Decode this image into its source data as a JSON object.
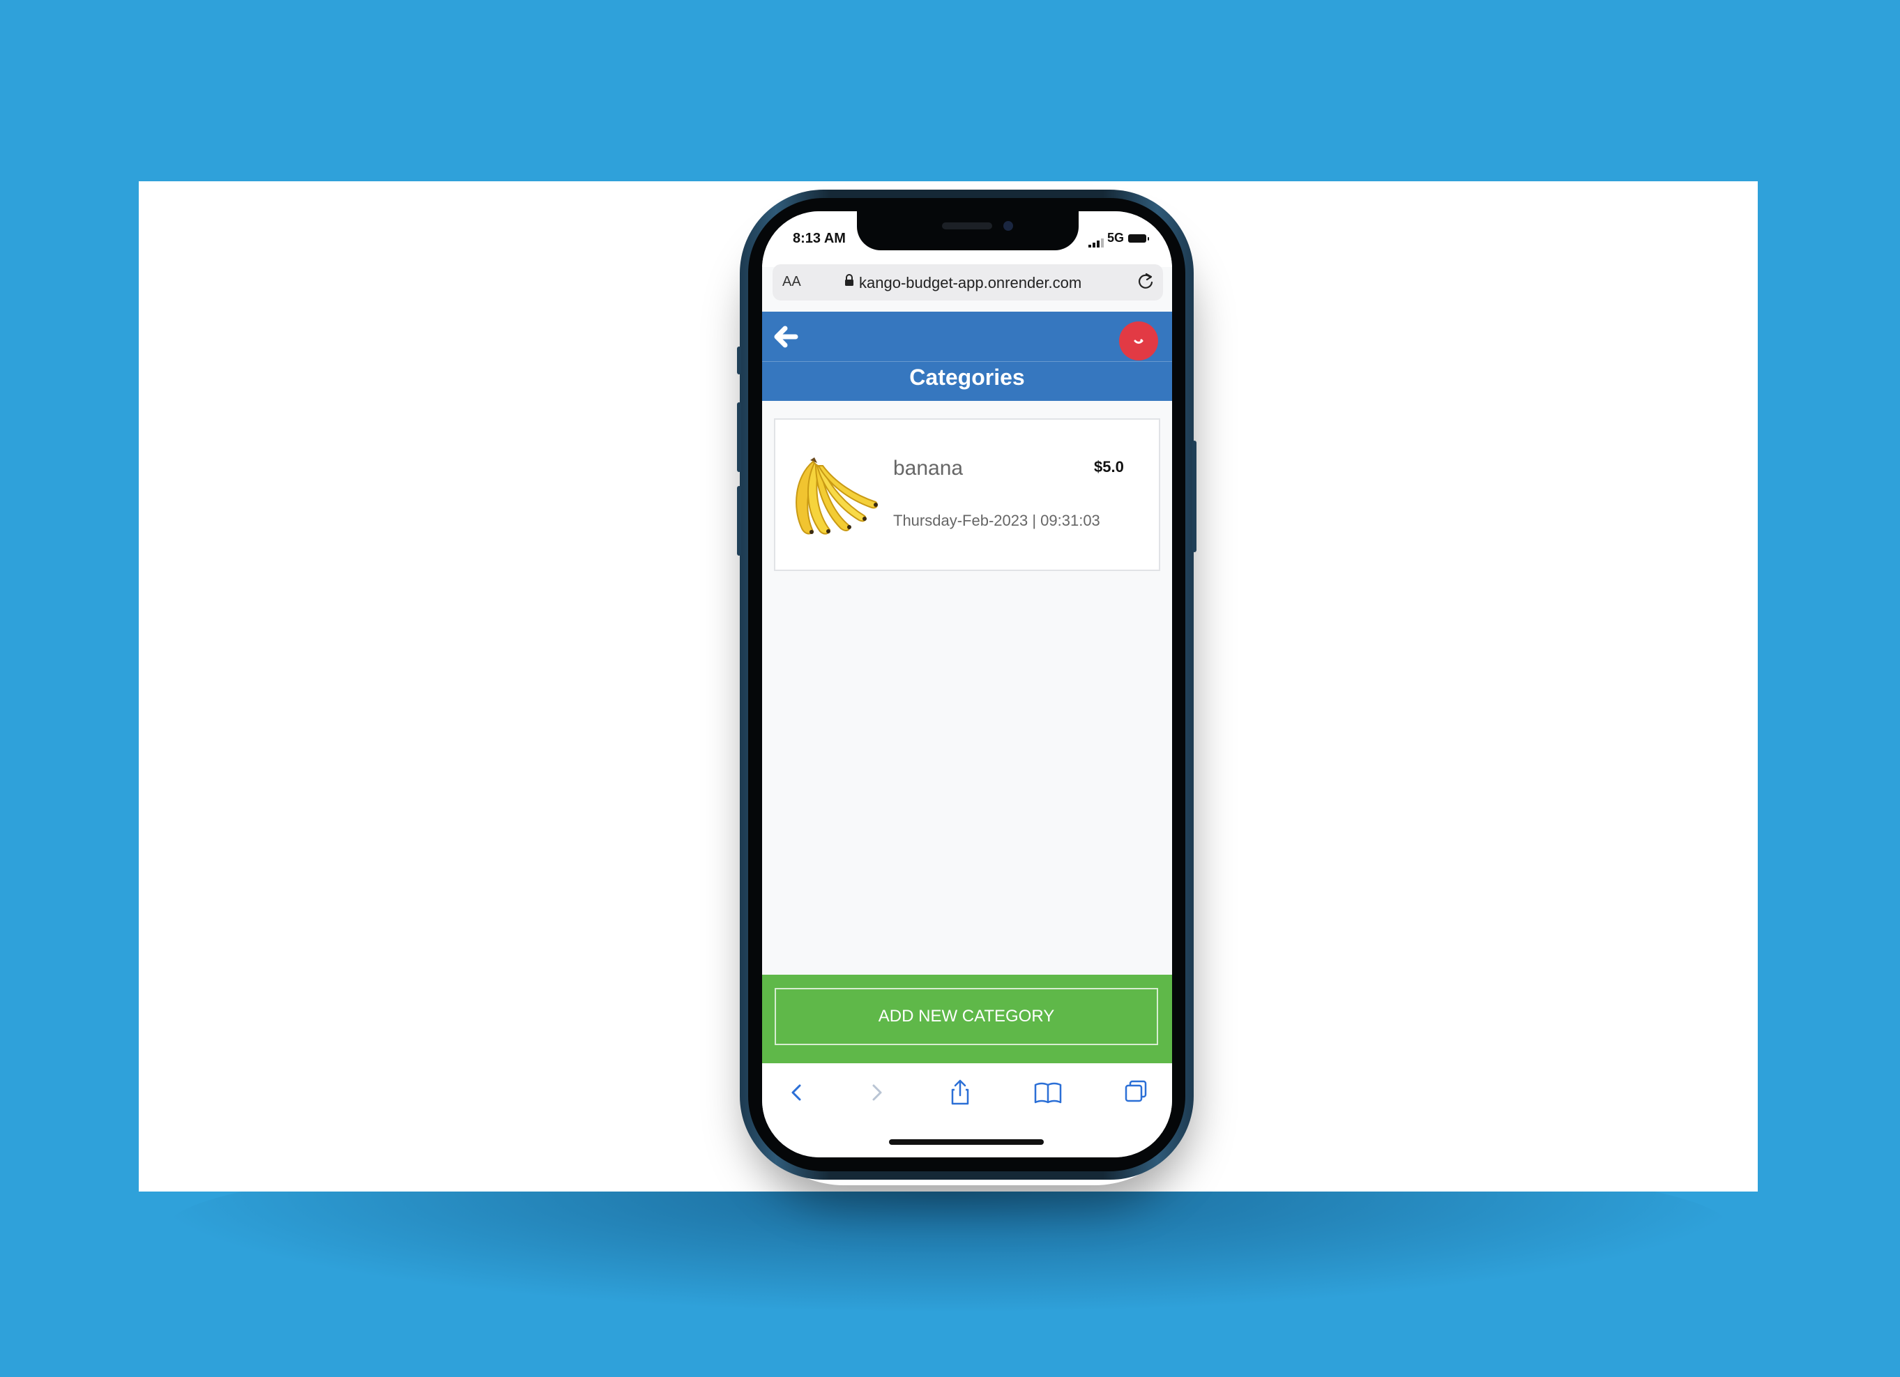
{
  "status_bar": {
    "time": "8:13 AM",
    "network": "5G"
  },
  "browser": {
    "text_size_label": "AA",
    "url": "kango-budget-app.onrender.com"
  },
  "header": {
    "title": "Categories"
  },
  "items": [
    {
      "name": "banana",
      "amount": "$5.0",
      "date": "Thursday-Feb-2023 | 09:31:03",
      "icon": "banana-image"
    }
  ],
  "actions": {
    "add_category_label": "ADD NEW CATEGORY"
  },
  "colors": {
    "header": "#3677bf",
    "add_bar": "#5fb849",
    "avatar": "#e23a44",
    "background": "#2fa1da"
  }
}
